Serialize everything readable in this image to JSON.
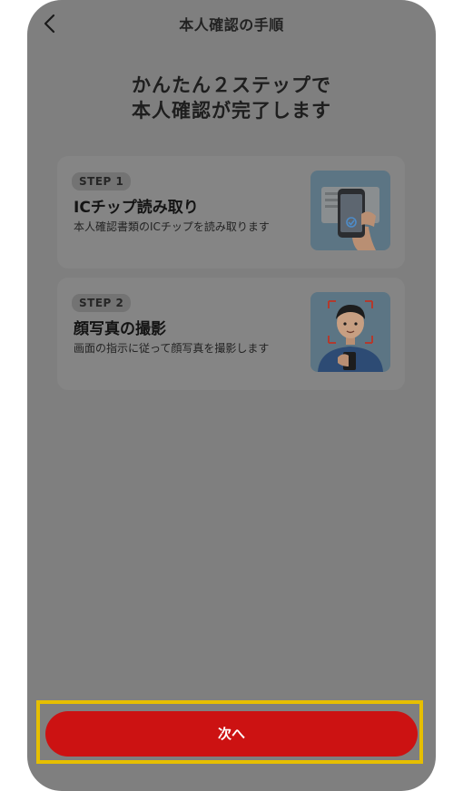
{
  "header": {
    "title": "本人確認の手順",
    "back_icon": "chevron-left-icon"
  },
  "headline": {
    "line1": "かんたん２ステップで",
    "line2": "本人確認が完了します"
  },
  "steps": [
    {
      "badge": "STEP 1",
      "title": "ICチップ読み取り",
      "description": "本人確認書類のICチップを読み取ります",
      "illustration": "phone-nfc-scan-illustration"
    },
    {
      "badge": "STEP 2",
      "title": "顔写真の撮影",
      "description": "画面の指示に従って顔写真を撮影します",
      "illustration": "selfie-illustration"
    }
  ],
  "cta": {
    "label": "次へ"
  },
  "colors": {
    "overlay": "#7f7f7f",
    "card": "#858585",
    "cta": "#cc1212",
    "highlight": "#e6bf00"
  }
}
